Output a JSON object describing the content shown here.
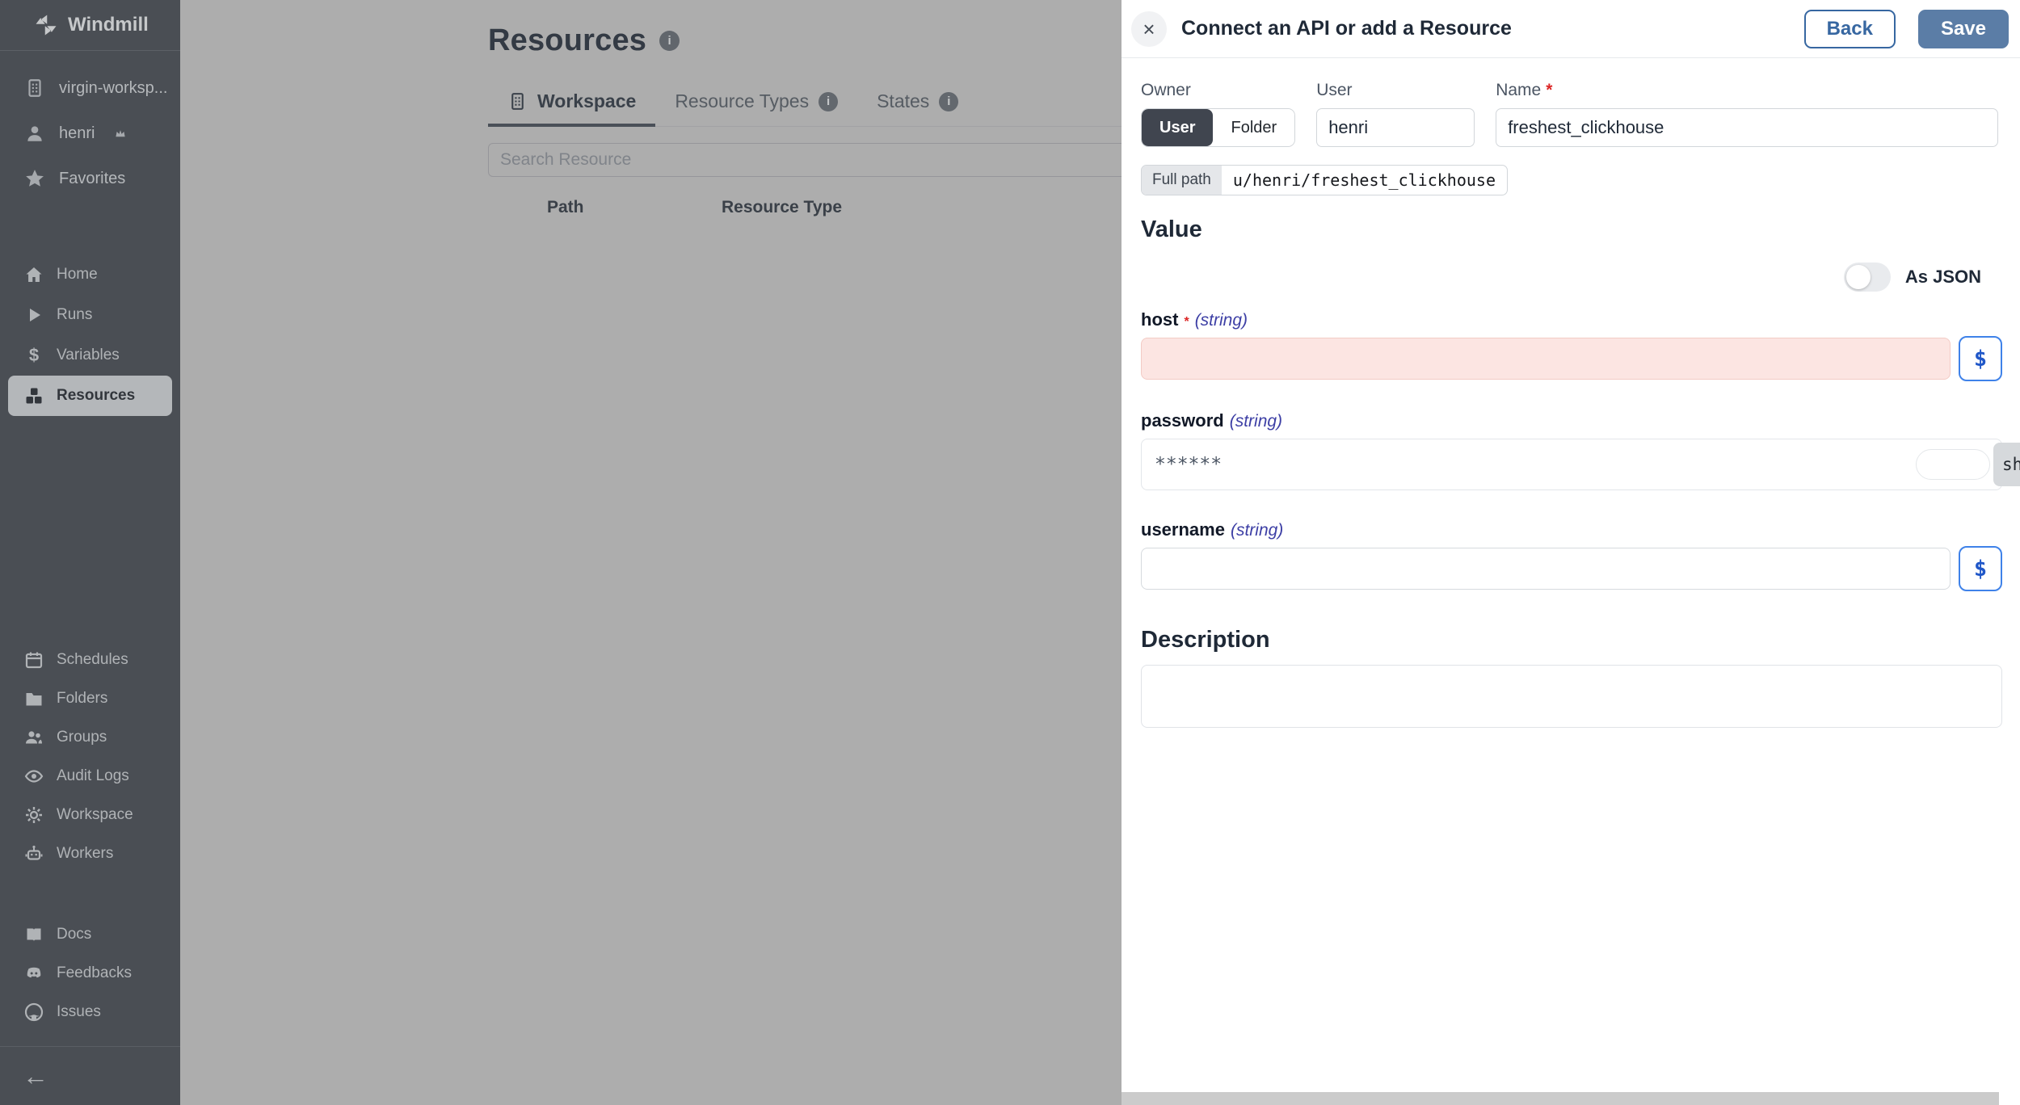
{
  "sidebar": {
    "brand": "Windmill",
    "workspace_name": "virgin-worksp...",
    "username": "henri",
    "favorites": "Favorites",
    "primary_items": [
      {
        "label": "Home",
        "icon": "home-icon"
      },
      {
        "label": "Runs",
        "icon": "play-icon"
      },
      {
        "label": "Variables",
        "icon": "dollar-icon"
      },
      {
        "label": "Resources",
        "icon": "boxes-icon",
        "active": true
      }
    ],
    "secondary_items": [
      {
        "label": "Schedules",
        "icon": "calendar-icon"
      },
      {
        "label": "Folders",
        "icon": "folder-icon"
      },
      {
        "label": "Groups",
        "icon": "groups-icon"
      },
      {
        "label": "Audit Logs",
        "icon": "eye-icon"
      },
      {
        "label": "Workspace",
        "icon": "gear-icon"
      },
      {
        "label": "Workers",
        "icon": "robot-icon"
      }
    ],
    "footer_items": [
      {
        "label": "Docs",
        "icon": "book-icon"
      },
      {
        "label": "Feedbacks",
        "icon": "discord-icon"
      },
      {
        "label": "Issues",
        "icon": "github-icon"
      }
    ],
    "collapse": "←"
  },
  "main": {
    "title": "Resources",
    "tabs": [
      {
        "label": "Workspace",
        "active": true
      },
      {
        "label": "Resource Types",
        "has_info": true
      },
      {
        "label": "States",
        "has_info": true
      }
    ],
    "search_placeholder": "Search Resource",
    "columns": [
      "Path",
      "Resource Type"
    ]
  },
  "drawer": {
    "title": "Connect an API or add a Resource",
    "close": "×",
    "back": "Back",
    "save": "Save",
    "owner": {
      "label": "Owner",
      "user_option": "User",
      "folder_option": "Folder",
      "selected": "User"
    },
    "user": {
      "label": "User",
      "value": "henri"
    },
    "name": {
      "label": "Name",
      "required": "*",
      "value": "freshest_clickhouse"
    },
    "full_path": {
      "label": "Full path",
      "value": "u/henri/freshest_clickhouse"
    },
    "value_heading": "Value",
    "as_json": "As JSON",
    "as_json_on": false,
    "dollar_button": "$",
    "fields": {
      "host": {
        "name": "host",
        "required": "*",
        "type": "(string)",
        "value": "",
        "invalid": true
      },
      "password": {
        "name": "password",
        "type": "(string)",
        "value": "******",
        "show": "sh"
      },
      "username": {
        "name": "username",
        "type": "(string)",
        "value": ""
      }
    },
    "description_heading": "Description",
    "description_value": ""
  },
  "colors": {
    "sidebar_bg": "#4a4e54",
    "overlay_gray": "#adadad",
    "save_bg": "#5b7da6",
    "back_blue": "#3767a1",
    "accent_blue": "#2057c8",
    "invalid_bg": "#fce5e2",
    "required_red": "#dc2626",
    "type_indigo": "#3d3fa5"
  }
}
